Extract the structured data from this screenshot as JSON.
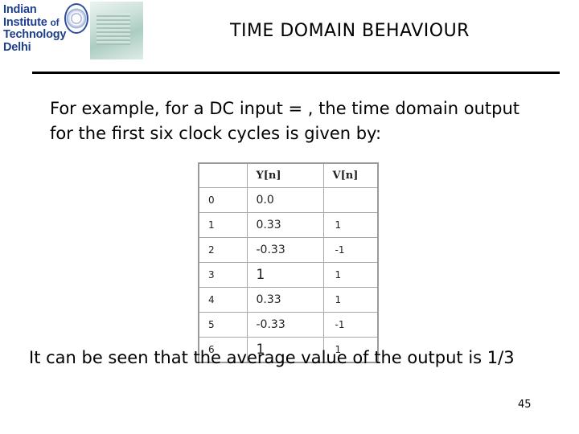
{
  "logo": {
    "lines": [
      "Indian",
      "Institute",
      "of",
      "Technology",
      "Delhi"
    ]
  },
  "slide": {
    "title": "TIME DOMAIN BEHAVIOUR",
    "intro_line1": "For example, for a DC input = , the time domain output",
    "intro_line2": "for the first six clock cycles is given by:",
    "conclusion": "It can be seen that the average value of the output is 1/3",
    "page_number": "45"
  },
  "table": {
    "headers": [
      "",
      "Y[n]",
      "V[n]"
    ],
    "rows": [
      {
        "n": "0",
        "y": "0.0",
        "v": ""
      },
      {
        "n": "1",
        "y": "0.33",
        "v": "1"
      },
      {
        "n": "2",
        "y": "-0.33",
        "v": "-1"
      },
      {
        "n": "3",
        "y": "1",
        "v": "1"
      },
      {
        "n": "4",
        "y": "0.33",
        "v": "1"
      },
      {
        "n": "5",
        "y": "-0.33",
        "v": "-1"
      },
      {
        "n": "6",
        "y": "1",
        "v": "1"
      }
    ]
  },
  "colors": {
    "logo_text": "#1d3f8f",
    "table_border": "#9a9a9a"
  }
}
